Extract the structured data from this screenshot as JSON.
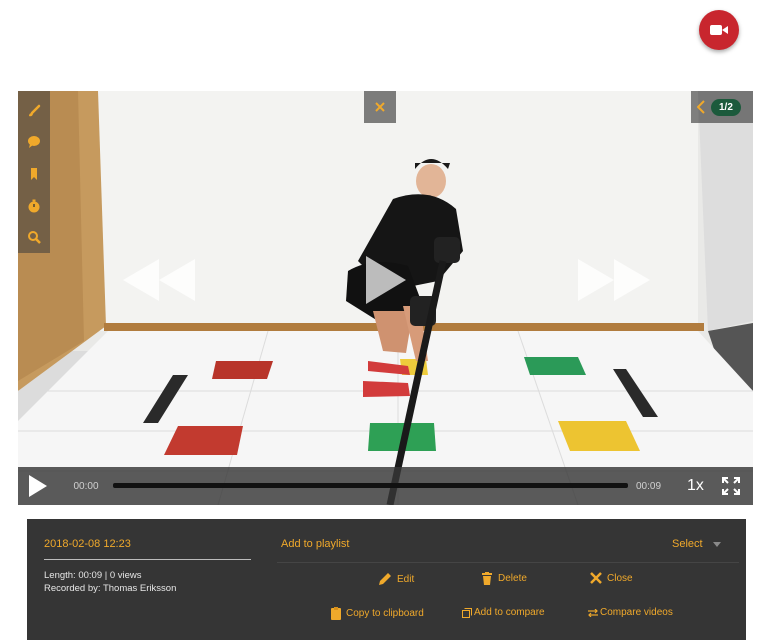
{
  "header": {
    "record_icon": "video-camera-icon"
  },
  "player": {
    "tools": [
      {
        "name": "brush-icon"
      },
      {
        "name": "speech-bubble-icon"
      },
      {
        "name": "bookmark-icon"
      },
      {
        "name": "stopwatch-icon"
      },
      {
        "name": "magnifier-icon"
      }
    ],
    "pager": {
      "label": "1/2"
    },
    "controls": {
      "current_time": "00:00",
      "duration": "00:09",
      "speed": "1x",
      "progress": 0
    }
  },
  "info": {
    "date": "2018-02-08 12:23",
    "length": "Length: 00:09 | 0 views",
    "recorded_by": "Recorded by: Thomas Eriksson",
    "add_to_playlist": "Add to playlist",
    "select": "Select",
    "actions": {
      "edit": "Edit",
      "delete": "Delete",
      "close": "Close",
      "copy": "Copy to clipboard",
      "compare": "Add to compare",
      "compare_videos": "Compare videos"
    }
  },
  "colors": {
    "accent": "#f0a92b",
    "record": "#c8262e",
    "panel": "#353535"
  }
}
